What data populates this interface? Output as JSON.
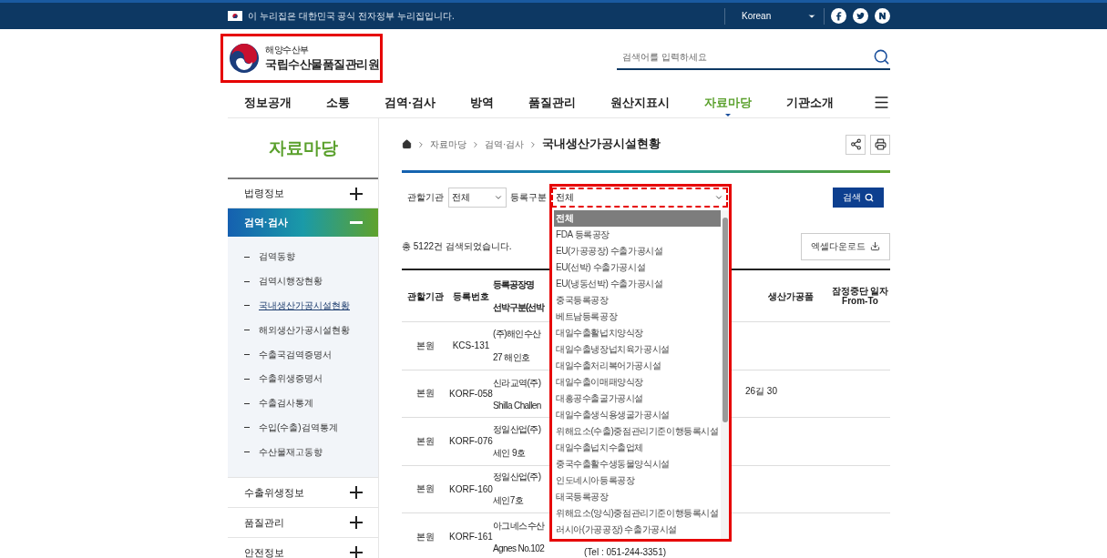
{
  "gov_banner": {
    "text": "이 누리집은 대한민국 공식 전자정부 누리집입니다.",
    "language": "Korean"
  },
  "header": {
    "ministry": "해양수산부",
    "agency": "국립수산물품질관리원",
    "search": {
      "placeholder": "검색어를 입력하세요"
    }
  },
  "nav": [
    {
      "label": "정보공개",
      "selected": false
    },
    {
      "label": "소통",
      "selected": false
    },
    {
      "label": "검역·검사",
      "selected": false
    },
    {
      "label": "방역",
      "selected": false
    },
    {
      "label": "품질관리",
      "selected": false
    },
    {
      "label": "원산지표시",
      "selected": false
    },
    {
      "label": "자료마당",
      "selected": true
    },
    {
      "label": "기관소개",
      "selected": false
    }
  ],
  "sidebar": {
    "title": "자료마당",
    "sections": [
      {
        "label": "법령정보",
        "expanded": false
      },
      {
        "label": "검역·검사",
        "expanded": true,
        "children": [
          {
            "label": "검역동향",
            "selected": false
          },
          {
            "label": "검역시행장현황",
            "selected": false
          },
          {
            "label": "국내생산가공시설현황",
            "selected": true
          },
          {
            "label": "해외생산가공시설현황",
            "selected": false
          },
          {
            "label": "수출국검역증명서",
            "selected": false
          },
          {
            "label": "수출위생증명서",
            "selected": false
          },
          {
            "label": "수출검사통계",
            "selected": false
          },
          {
            "label": "수입(수출)검역통계",
            "selected": false
          },
          {
            "label": "수산물재고동향",
            "selected": false
          }
        ]
      },
      {
        "label": "수출위생정보",
        "expanded": false
      },
      {
        "label": "품질관리",
        "expanded": false
      },
      {
        "label": "안전정보",
        "expanded": false
      }
    ]
  },
  "breadcrumb": [
    "자료마당",
    "검역·검사"
  ],
  "page_title": "국내생산가공시설현황",
  "filters": [
    {
      "label": "관할기관",
      "value": "전체"
    },
    {
      "label": "등록구분",
      "value": "전체",
      "open": true,
      "options": [
        {
          "label": "전체",
          "selected": true
        },
        {
          "label": "FDA 등록공장",
          "selected": false
        },
        {
          "label": "EU(가공공장) 수출가공시설",
          "selected": false
        },
        {
          "label": "EU(선박) 수출가공시설",
          "selected": false
        },
        {
          "label": "EU(냉동선박) 수출가공시설",
          "selected": false
        },
        {
          "label": "중국등록공장",
          "selected": false
        },
        {
          "label": "베트남등록공장",
          "selected": false
        },
        {
          "label": "대일수출활넙치양식장",
          "selected": false
        },
        {
          "label": "대일수출냉장넙치육가공시설",
          "selected": false
        },
        {
          "label": "대일수출처리복어가공시설",
          "selected": false
        },
        {
          "label": "대일수출이매패양식장",
          "selected": false
        },
        {
          "label": "대흥공수출굴가공시설",
          "selected": false
        },
        {
          "label": "대일수출생식용생굴가공시설",
          "selected": false
        },
        {
          "label": "위해요소(수출)중점관리기준이행등록시설",
          "selected": false
        },
        {
          "label": "대일수출넙치수출업체",
          "selected": false
        },
        {
          "label": "중국수출활수생동물양식시설",
          "selected": false
        },
        {
          "label": "인도네시아등록공장",
          "selected": false
        },
        {
          "label": "태국등록공장",
          "selected": false
        },
        {
          "label": "위해요소(양식)중점관리기준이행등록시설",
          "selected": false
        },
        {
          "label": "러시아(가공공장) 수출가공시설",
          "selected": false
        }
      ]
    }
  ],
  "search_button": "검색",
  "result_count": "총 5122건 검색되었습니다.",
  "excel_button": "엑셀다운로드",
  "table": {
    "columns": [
      {
        "lines": [
          "관할기관"
        ]
      },
      {
        "lines": [
          "등록번호"
        ]
      },
      {
        "lines": [
          "등록공장명",
          "선박구분(선박"
        ]
      },
      {
        "lines": [
          "생산가공품"
        ]
      },
      {
        "lines": [
          "잠정중단 일자",
          "From-To"
        ]
      }
    ],
    "rows": [
      {
        "agency": "본원",
        "number": "KCS-131",
        "name_lines": [
          "(주)해인수산",
          "27 해인호"
        ]
      },
      {
        "agency": "본원",
        "number": "KORF-058",
        "name_lines": [
          "신라교역(주)",
          "Shilla Challen"
        ],
        "address": "26길 30"
      },
      {
        "agency": "본원",
        "number": "KORF-076",
        "name_lines": [
          "정일산업(주)",
          "세인 9호"
        ]
      },
      {
        "agency": "본원",
        "number": "KORF-160",
        "name_lines": [
          "정일산업(주)",
          "세인7호"
        ]
      },
      {
        "agency": "본원",
        "number": "KORF-161",
        "name_lines": [
          "아그네스수산",
          "Agnes No.102"
        ],
        "address_note": "(Tel : 051-244-3351)"
      }
    ]
  }
}
